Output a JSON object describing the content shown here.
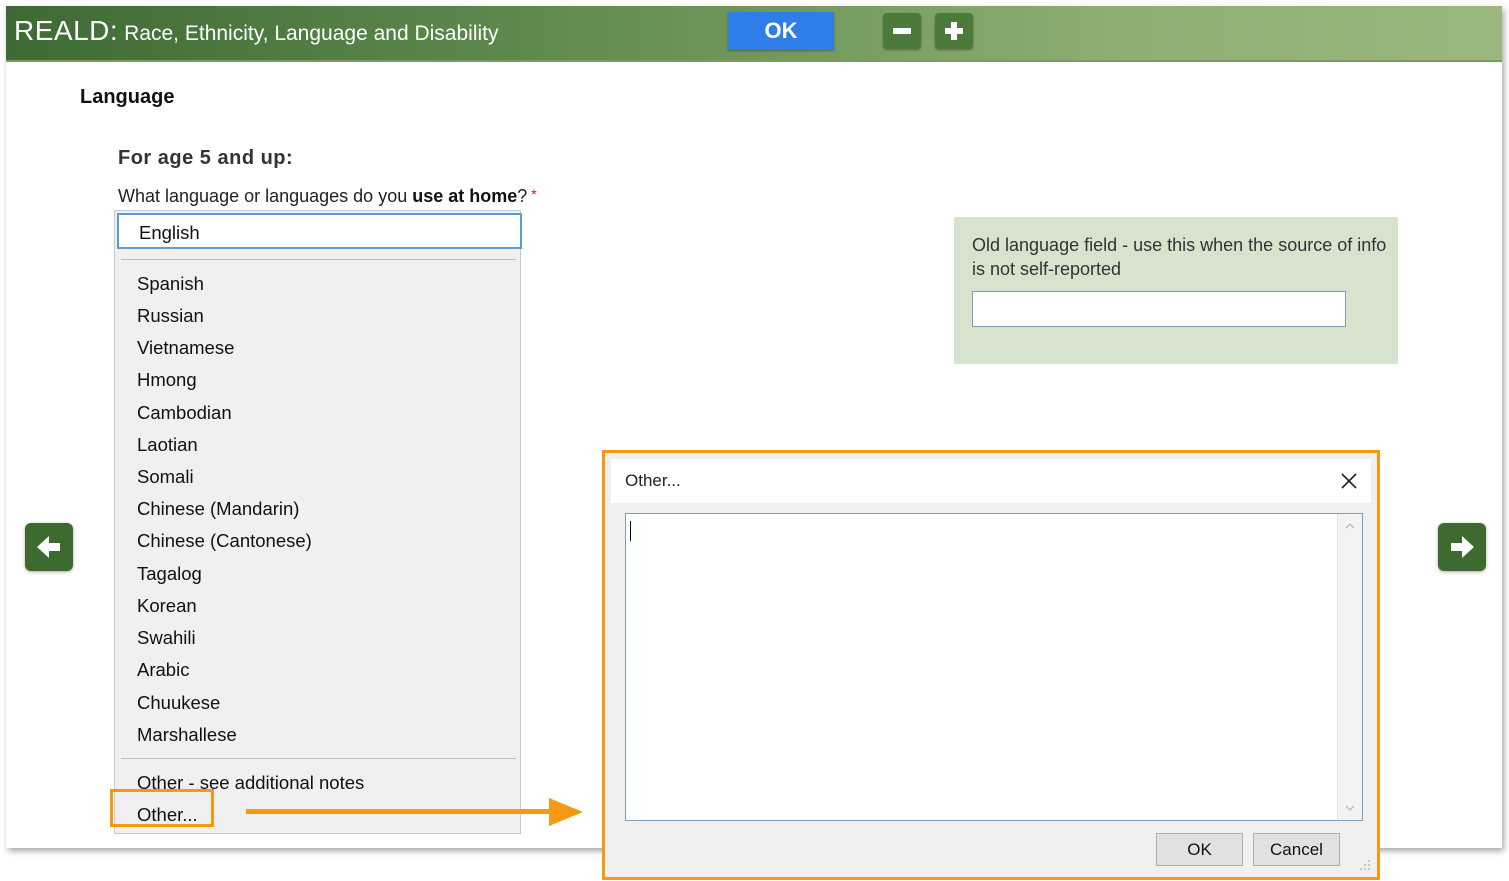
{
  "header": {
    "title_main": "REALD:",
    "title_sub": "Race, Ethnicity, Language and Disability",
    "ok_label": "OK",
    "zoom_out_icon": "minus-icon",
    "zoom_in_icon": "plus-icon",
    "colors": {
      "header_start": "#3e6a34",
      "header_end": "#9ab87d",
      "ok_button": "#2f7de8",
      "zoom_button": "#4c7a3b"
    }
  },
  "section": {
    "title": "Language",
    "age_label": "For age 5 and up:",
    "question_prefix": "What language or languages do you ",
    "question_bold": "use at home",
    "question_suffix": "?",
    "required_mark": "*"
  },
  "language_list": {
    "selected": "English",
    "items": [
      "Spanish",
      "Russian",
      "Vietnamese",
      "Hmong",
      "Cambodian",
      "Laotian",
      "Somali",
      "Chinese (Mandarin)",
      "Chinese (Cantonese)",
      "Tagalog",
      "Korean",
      "Swahili",
      "Arabic",
      "Chuukese",
      "Marshallese"
    ],
    "other_notes": "Other - see additional notes",
    "other_custom": "Other..."
  },
  "old_language": {
    "label": "Old language field - use this when the source of info is not self-reported",
    "value": ""
  },
  "navigation": {
    "prev_icon": "arrow-left-icon",
    "next_icon": "arrow-right-icon"
  },
  "dialog": {
    "title": "Other...",
    "text_value": "",
    "ok_label": "OK",
    "cancel_label": "Cancel",
    "close_icon": "close-icon",
    "highlight_color": "#f39a12"
  }
}
